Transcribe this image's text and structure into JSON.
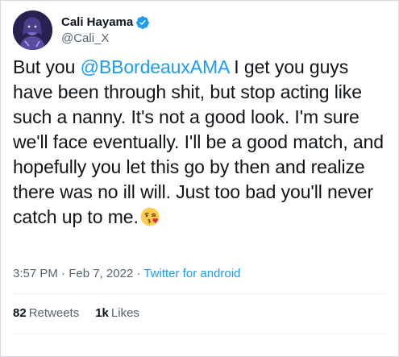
{
  "user": {
    "display_name": "Cali Hayama",
    "handle": "@Cali_X",
    "verified": true
  },
  "tweet": {
    "parts": [
      "But you ",
      "@BBordeauxAMA",
      " I get you guys have been through shit, but stop acting like such a nanny. It's not a good look. I'm sure we'll face eventually. I'll be a good match, and hopefully you let this go by then and realize there was no ill will. Just too bad you'll never catch up to me."
    ],
    "emoji": "face-blowing-a-kiss"
  },
  "meta": {
    "time": "3:57 PM",
    "separator1": " · ",
    "date": "Feb 7, 2022",
    "separator2": " · ",
    "source": "Twitter for android"
  },
  "stats": {
    "retweets_count": "82",
    "retweets_label": "Retweets",
    "likes_count": "1k",
    "likes_label": "Likes"
  },
  "colors": {
    "link": "#1d9bf0",
    "text": "#0f1419",
    "secondary": "#536471",
    "border": "#cfd9de"
  }
}
